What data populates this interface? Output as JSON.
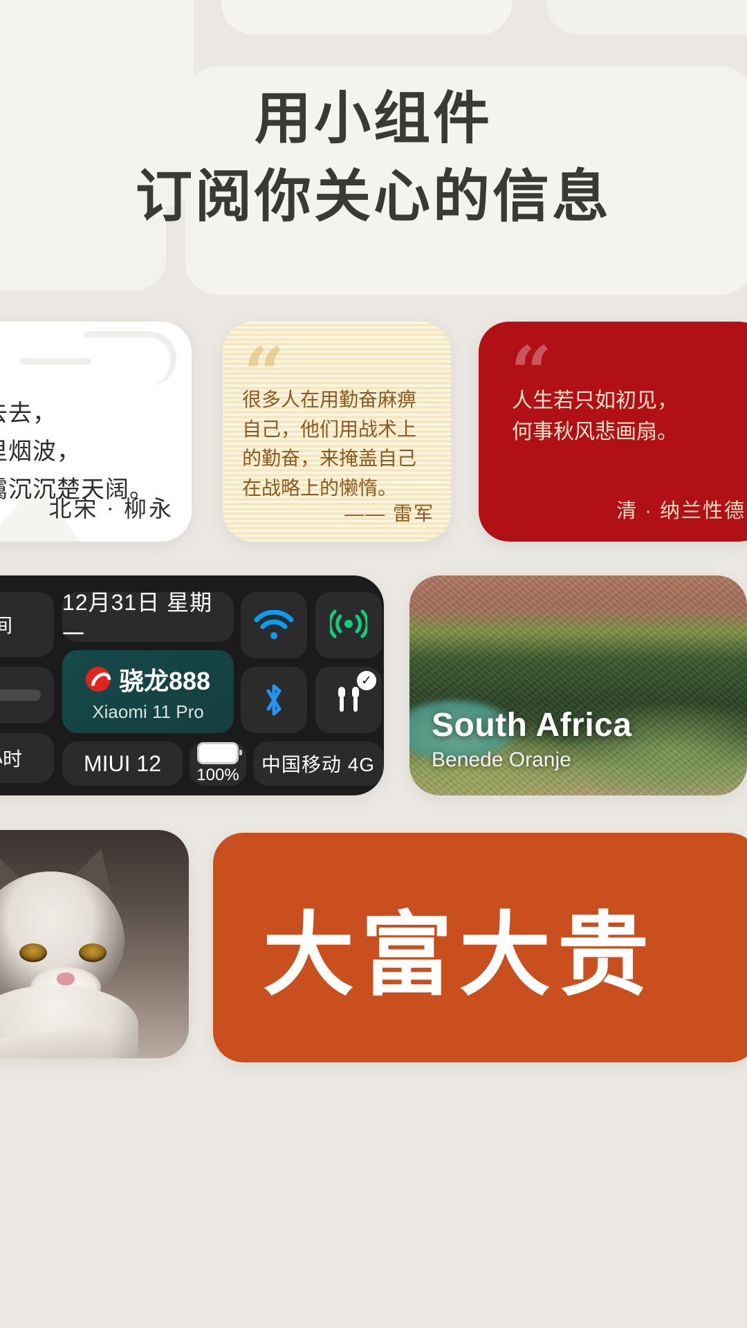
{
  "hero": {
    "headline_line1": "用小组件",
    "headline_line2": "订阅你关心的信息"
  },
  "widgets": {
    "poem": {
      "name": "poem-widget",
      "text": "念去去，\n千里烟波，\n暮霭沉沉楚天阔。",
      "author": "北宋 · 柳永"
    },
    "quote_yellow": {
      "name": "quote-widget-yellow",
      "quote_mark": "“",
      "text": "很多人在用勤奋麻痹自己，他们用战术上的勤奋，来掩盖自己在战略上的懒惰。",
      "attribution": "—— 雷军",
      "bg_color": "#fbeecb",
      "text_color": "#8c5a21"
    },
    "quote_red": {
      "name": "quote-widget-red",
      "quote_mark": "“",
      "text": "人生若只如初见，\n何事秋风悲画扇。",
      "attribution": "清 · 纳兰性德",
      "bg_color": "#b01016",
      "text_color": "#f6e2c9"
    },
    "system": {
      "name": "system-info-widget",
      "bg_color": "#1b1b1b",
      "date": "12月31日  星期一",
      "cpu_name": "骁龙888",
      "device_model": "Xiaomi 11 Pro",
      "os_version": "MIUI 12",
      "battery_percent": "100%",
      "carrier": "中国移动  4G",
      "time_label": "间",
      "hours_label": "小时",
      "wifi_icon": "wifi-icon",
      "cellular_icon": "cellular-signal-icon",
      "bluetooth_icon": "bluetooth-icon",
      "earbuds_icon": "earbuds-icon",
      "earbuds_connected_badge": "✓",
      "wifi_color": "#0b9cf5",
      "cellular_color": "#0fd07a",
      "bluetooth_color": "#2196f3",
      "cpu_bg_color": "#15494a"
    },
    "map": {
      "name": "satellite-map-widget",
      "title": "South Africa",
      "subtitle": "Benede Oranje"
    },
    "photo": {
      "name": "photo-widget-cat"
    },
    "fortune": {
      "name": "fortune-widget",
      "text": "大富大贵",
      "bg_color": "#c9501e",
      "text_color": "#ffffff"
    }
  }
}
